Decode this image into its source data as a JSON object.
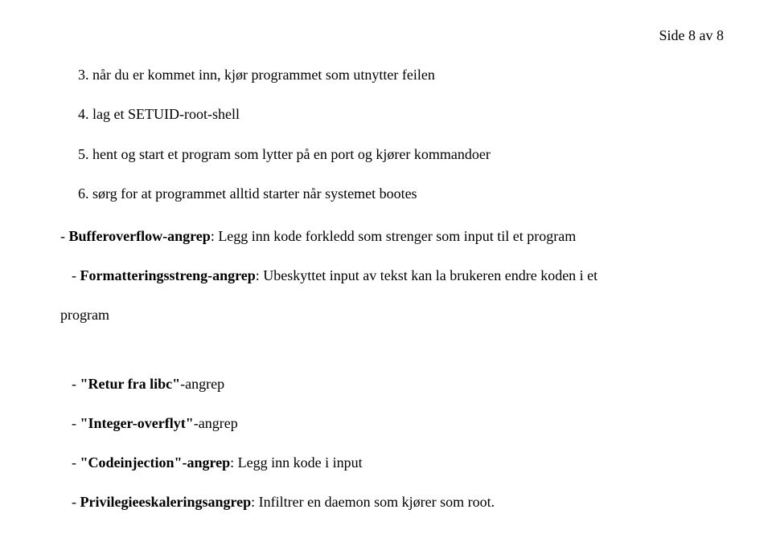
{
  "pageNumber": "Side 8 av 8",
  "numbered": {
    "item3": "3. når du er kommet inn, kjør programmet som utnytter feilen",
    "item4": "4. lag et SETUID-root-shell",
    "item5": "5. hent og start et program som lytter på en port og kjører kommandoer",
    "item6": "6. sørg for at programmet alltid starter når systemet bootes"
  },
  "attacks": {
    "bufferOverflow": {
      "prefix": "- ",
      "bold": "Bufferoverflow-angrep",
      "rest": ": Legg inn kode forkledd som strenger som input til et program"
    },
    "formatString": {
      "prefix": " - ",
      "bold": "Formatteringsstreng-angrep",
      "rest": ": Ubeskyttet input av tekst kan la brukeren endre koden i et"
    },
    "formatStringTrailing": "program",
    "returnLibc": {
      "prefix": " - ",
      "boldQuoted": "\"Retur fra libc\"",
      "rest": "-angrep"
    },
    "integerOverflow": {
      "prefix": " - ",
      "boldQuoted": "\"Integer-overflyt\"",
      "rest": "-angrep"
    },
    "codeInjection": {
      "prefix": " - ",
      "boldQuoted": "\"Codeinjection\"",
      "restBoldPart": "-angrep",
      "rest": ": Legg inn kode i input"
    },
    "privEscalation": {
      "prefix": " - ",
      "bold": "Privilegieeskaleringsangrep",
      "rest": ": Infiltrer en daemon som kjører som root."
    }
  }
}
